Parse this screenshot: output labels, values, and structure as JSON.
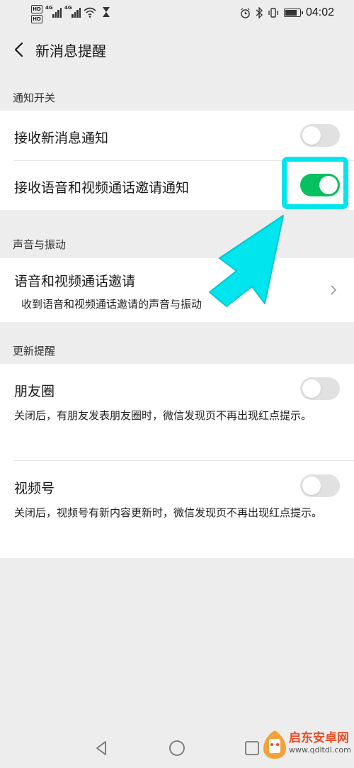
{
  "statusbar": {
    "hd_badges": [
      "HD",
      "HD"
    ],
    "signal_labels": [
      "4G",
      "4G"
    ],
    "time": "04:02",
    "battery_level": 0.85
  },
  "header": {
    "title": "新消息提醒"
  },
  "sections": {
    "notify_switch": {
      "label": "通知开关",
      "rows": [
        {
          "title": "接收新消息通知",
          "toggle_on": false
        },
        {
          "title": "接收语音和视频通话邀请通知",
          "toggle_on": true
        }
      ]
    },
    "sound_vibration": {
      "label": "声音与振动",
      "row": {
        "title": "语音和视频通话邀请",
        "desc": "收到语音和视频通话邀请的声音与振动"
      }
    },
    "updates": {
      "label": "更新提醒",
      "rows": [
        {
          "title": "朋友圈",
          "desc": "关闭后，有朋友发表朋友圈时，微信发现页不再出现红点提示。",
          "toggle_on": false
        },
        {
          "title": "视频号",
          "desc": "关闭后，视频号有新内容更新时，微信发现页不再出现红点提示。",
          "toggle_on": false
        }
      ]
    }
  },
  "watermark": {
    "name": "启东安卓网",
    "url": "www.qdltdl.com"
  },
  "colors": {
    "accent": "#07c160",
    "highlight": "#00e5ee",
    "background": "#ededed"
  }
}
